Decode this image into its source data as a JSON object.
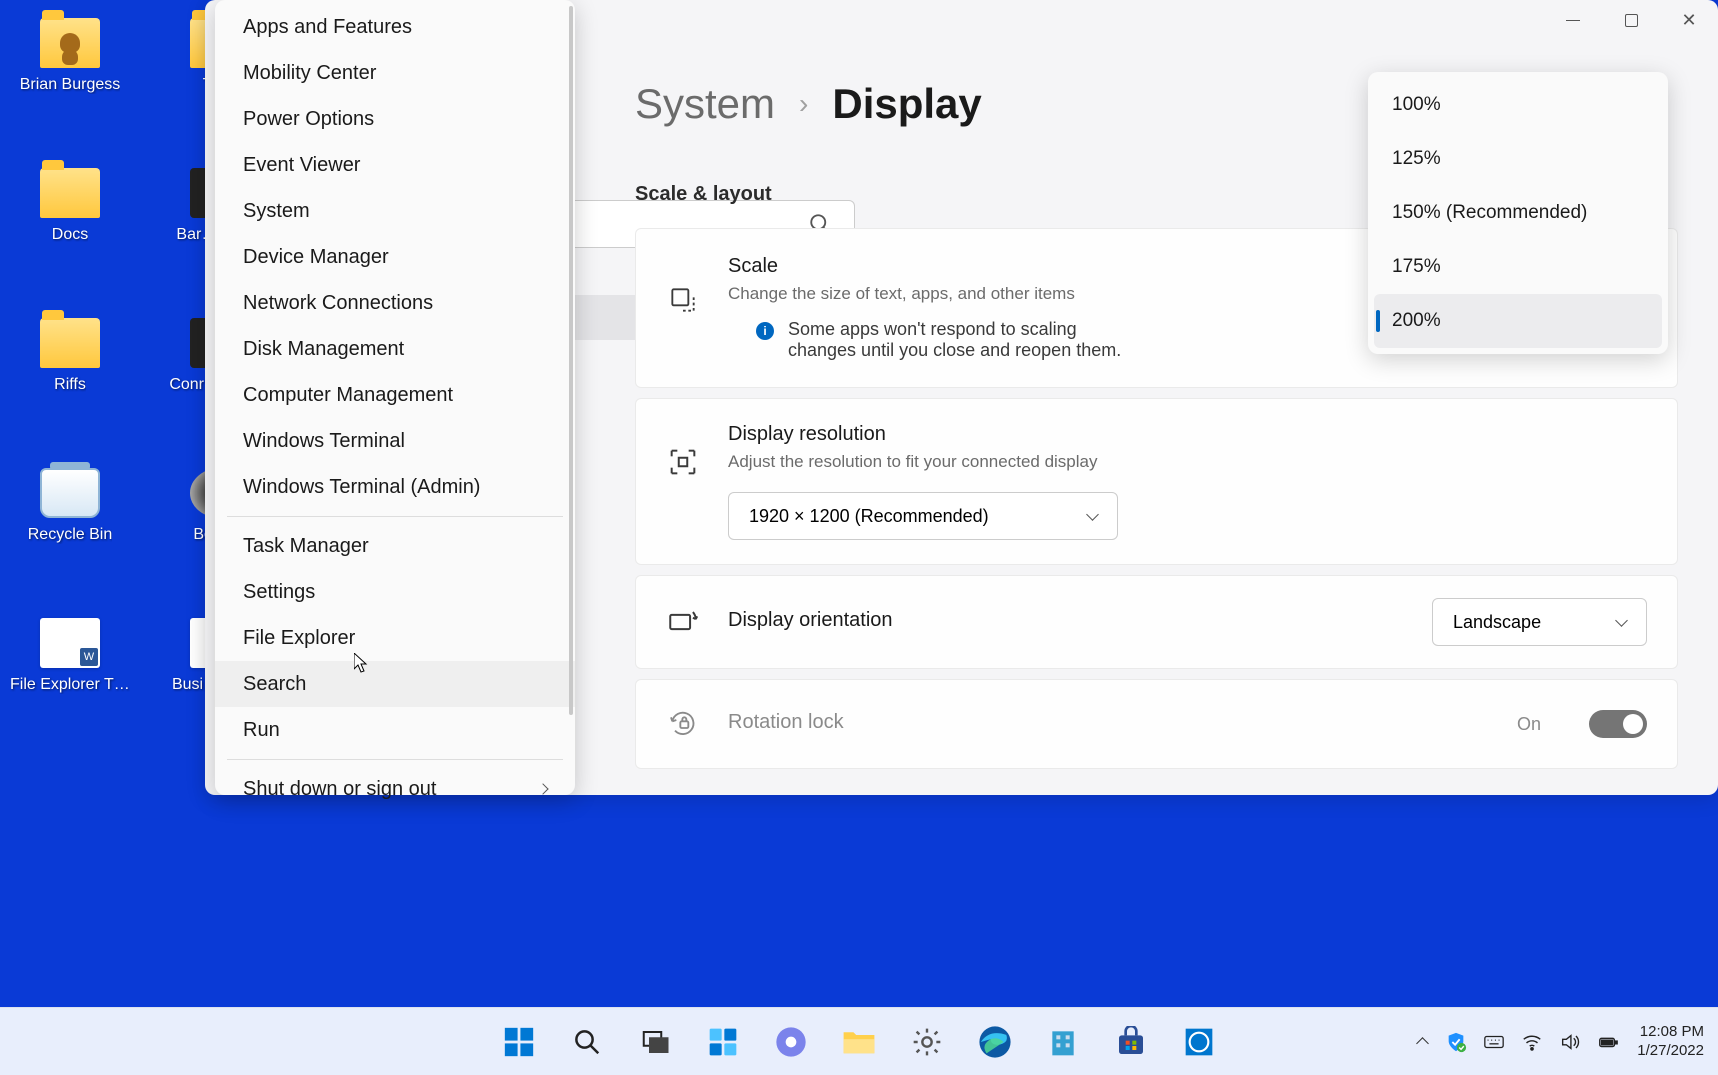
{
  "desktop": {
    "icons": [
      {
        "label": "Brian Burgess",
        "kind": "user-folder"
      },
      {
        "label": "Th…",
        "kind": "folder"
      },
      {
        "label": "Docs",
        "kind": "folder"
      },
      {
        "label": "Bar… Ass…",
        "kind": "dark"
      },
      {
        "label": "Riffs",
        "kind": "folder"
      },
      {
        "label": "Conr… Mes…",
        "kind": "dark"
      },
      {
        "label": "Recycle Bin",
        "kind": "recycle"
      },
      {
        "label": "Boon…",
        "kind": "disc"
      },
      {
        "label": "File Explorer This PC Wi...",
        "kind": "doc"
      },
      {
        "label": "Busi… Bud…",
        "kind": "xls"
      }
    ]
  },
  "winx_menu": {
    "items": [
      "Apps and Features",
      "Mobility Center",
      "Power Options",
      "Event Viewer",
      "System",
      "Device Manager",
      "Network Connections",
      "Disk Management",
      "Computer Management",
      "Windows Terminal",
      "Windows Terminal (Admin)",
      "__sep__",
      "Task Manager",
      "Settings",
      "File Explorer",
      "Search",
      "Run",
      "__sep__",
      "Shut down or sign out"
    ],
    "hovered": "Search",
    "has_submenu": [
      "Shut down or sign out"
    ]
  },
  "settings": {
    "breadcrumb_parent": "System",
    "breadcrumb_current": "Display",
    "section_title": "Scale & layout",
    "scale": {
      "title": "Scale",
      "subtitle": "Change the size of text, apps, and other items",
      "note": "Some apps won't respond to scaling changes until you close and reopen them.",
      "options": [
        "100%",
        "125%",
        "150% (Recommended)",
        "175%",
        "200%"
      ],
      "selected": "200%"
    },
    "resolution": {
      "title": "Display resolution",
      "subtitle": "Adjust the resolution to fit your connected display",
      "value": "1920 × 1200 (Recommended)"
    },
    "orientation": {
      "title": "Display orientation",
      "value": "Landscape"
    },
    "rotation_lock": {
      "title": "Rotation lock",
      "state": "On"
    }
  },
  "taskbar": {
    "center_items": [
      "start",
      "search",
      "task-view",
      "widgets",
      "teams",
      "file-explorer",
      "settings",
      "edge",
      "company-portal",
      "microsoft-store",
      "dell"
    ],
    "tray": [
      "security",
      "keyboard",
      "wifi",
      "volume",
      "battery"
    ],
    "clock": {
      "time": "12:08 PM",
      "date": "1/27/2022"
    }
  }
}
